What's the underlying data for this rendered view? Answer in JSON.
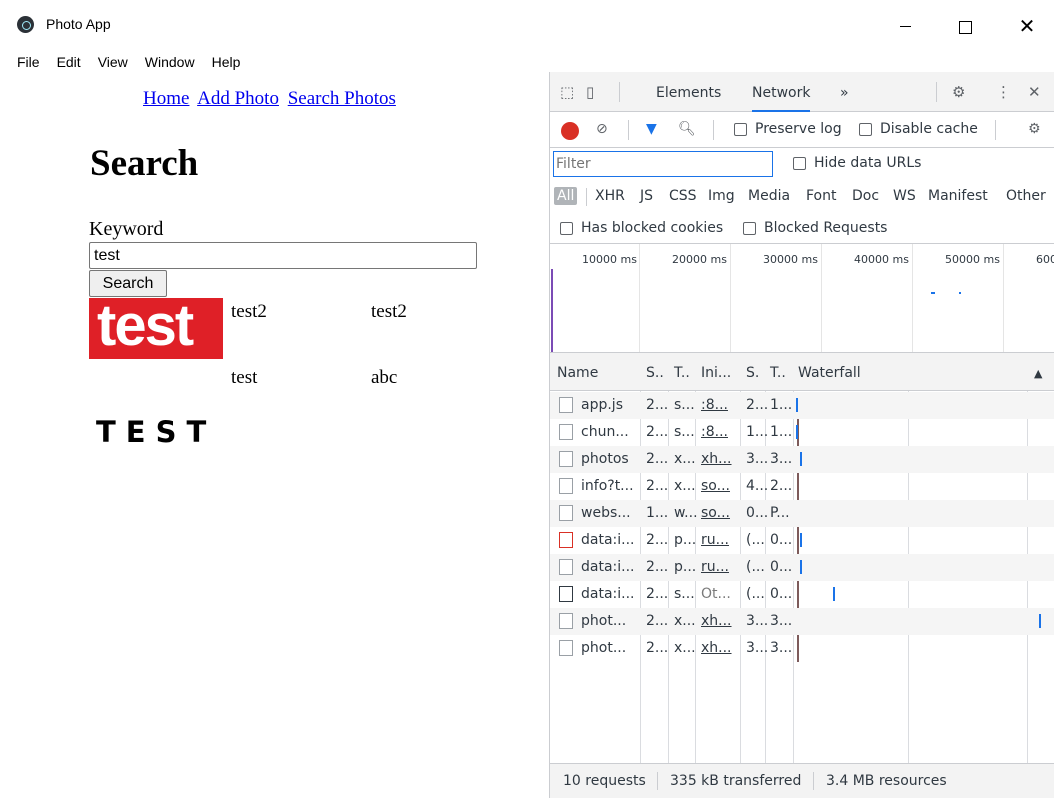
{
  "window": {
    "title": "Photo App"
  },
  "menu": [
    "File",
    "Edit",
    "View",
    "Window",
    "Help"
  ],
  "app": {
    "nav": [
      "Home",
      "Add Photo",
      "Search Photos"
    ],
    "heading": "Search",
    "keyword_label": "Keyword",
    "keyword_value": "test",
    "search_button": "Search",
    "results": [
      {
        "thumb_text": "test",
        "col1": "test2",
        "col2": "test2"
      },
      {
        "thumb_text": "",
        "col1": "test",
        "col2": "abc"
      },
      {
        "thumb_text": "TEST",
        "col1": "",
        "col2": ""
      }
    ]
  },
  "devtools": {
    "tabs": [
      "Elements",
      "Network",
      "»"
    ],
    "active_tab": "Network",
    "toolbar": {
      "preserve_log": "Preserve log",
      "disable_cache": "Disable cache"
    },
    "filter": {
      "placeholder": "Filter",
      "hide_data_urls": "Hide data URLs"
    },
    "types": [
      "All",
      "XHR",
      "JS",
      "CSS",
      "Img",
      "Media",
      "Font",
      "Doc",
      "WS",
      "Manifest",
      "Other"
    ],
    "blocked": {
      "has_blocked_cookies": "Has blocked cookies",
      "blocked_requests": "Blocked Requests"
    },
    "timeline_ticks": [
      "10000 ms",
      "20000 ms",
      "30000 ms",
      "40000 ms",
      "50000 ms",
      "600"
    ],
    "columns": [
      "Name",
      "S..",
      "T..",
      "Ini...",
      "S.",
      "T..",
      "Waterfall"
    ],
    "rows": [
      {
        "name": "app.js",
        "s": "2...",
        "t": "s...",
        "ini": ":8...",
        "size": "2...",
        "time": "1..."
      },
      {
        "name": "chun...",
        "s": "2...",
        "t": "s...",
        "ini": ":8...",
        "size": "1...",
        "time": "1..."
      },
      {
        "name": "photos",
        "s": "2...",
        "t": "x...",
        "ini": "xh...",
        "size": "3...",
        "time": "3..."
      },
      {
        "name": "info?t...",
        "s": "2...",
        "t": "x...",
        "ini": "so...",
        "size": "4...",
        "time": "2..."
      },
      {
        "name": "webs...",
        "s": "1...",
        "t": "w...",
        "ini": "so...",
        "size": "0...",
        "time": "P..."
      },
      {
        "name": "data:i...",
        "s": "2...",
        "t": "p...",
        "ini": "ru...",
        "size": "(...",
        "time": "0..."
      },
      {
        "name": "data:i...",
        "s": "2...",
        "t": "p...",
        "ini": "ru...",
        "size": "(...",
        "time": "0..."
      },
      {
        "name": "data:i...",
        "s": "2...",
        "t": "s...",
        "ini": "Ot...",
        "size": "(...",
        "time": "0..."
      },
      {
        "name": "phot...",
        "s": "2...",
        "t": "x...",
        "ini": "xh...",
        "size": "3...",
        "time": "3..."
      },
      {
        "name": "phot...",
        "s": "2...",
        "t": "x...",
        "ini": "xh...",
        "size": "3...",
        "time": "3..."
      }
    ],
    "status": {
      "requests": "10 requests",
      "transferred": "335 kB transferred",
      "resources": "3.4 MB resources"
    }
  }
}
